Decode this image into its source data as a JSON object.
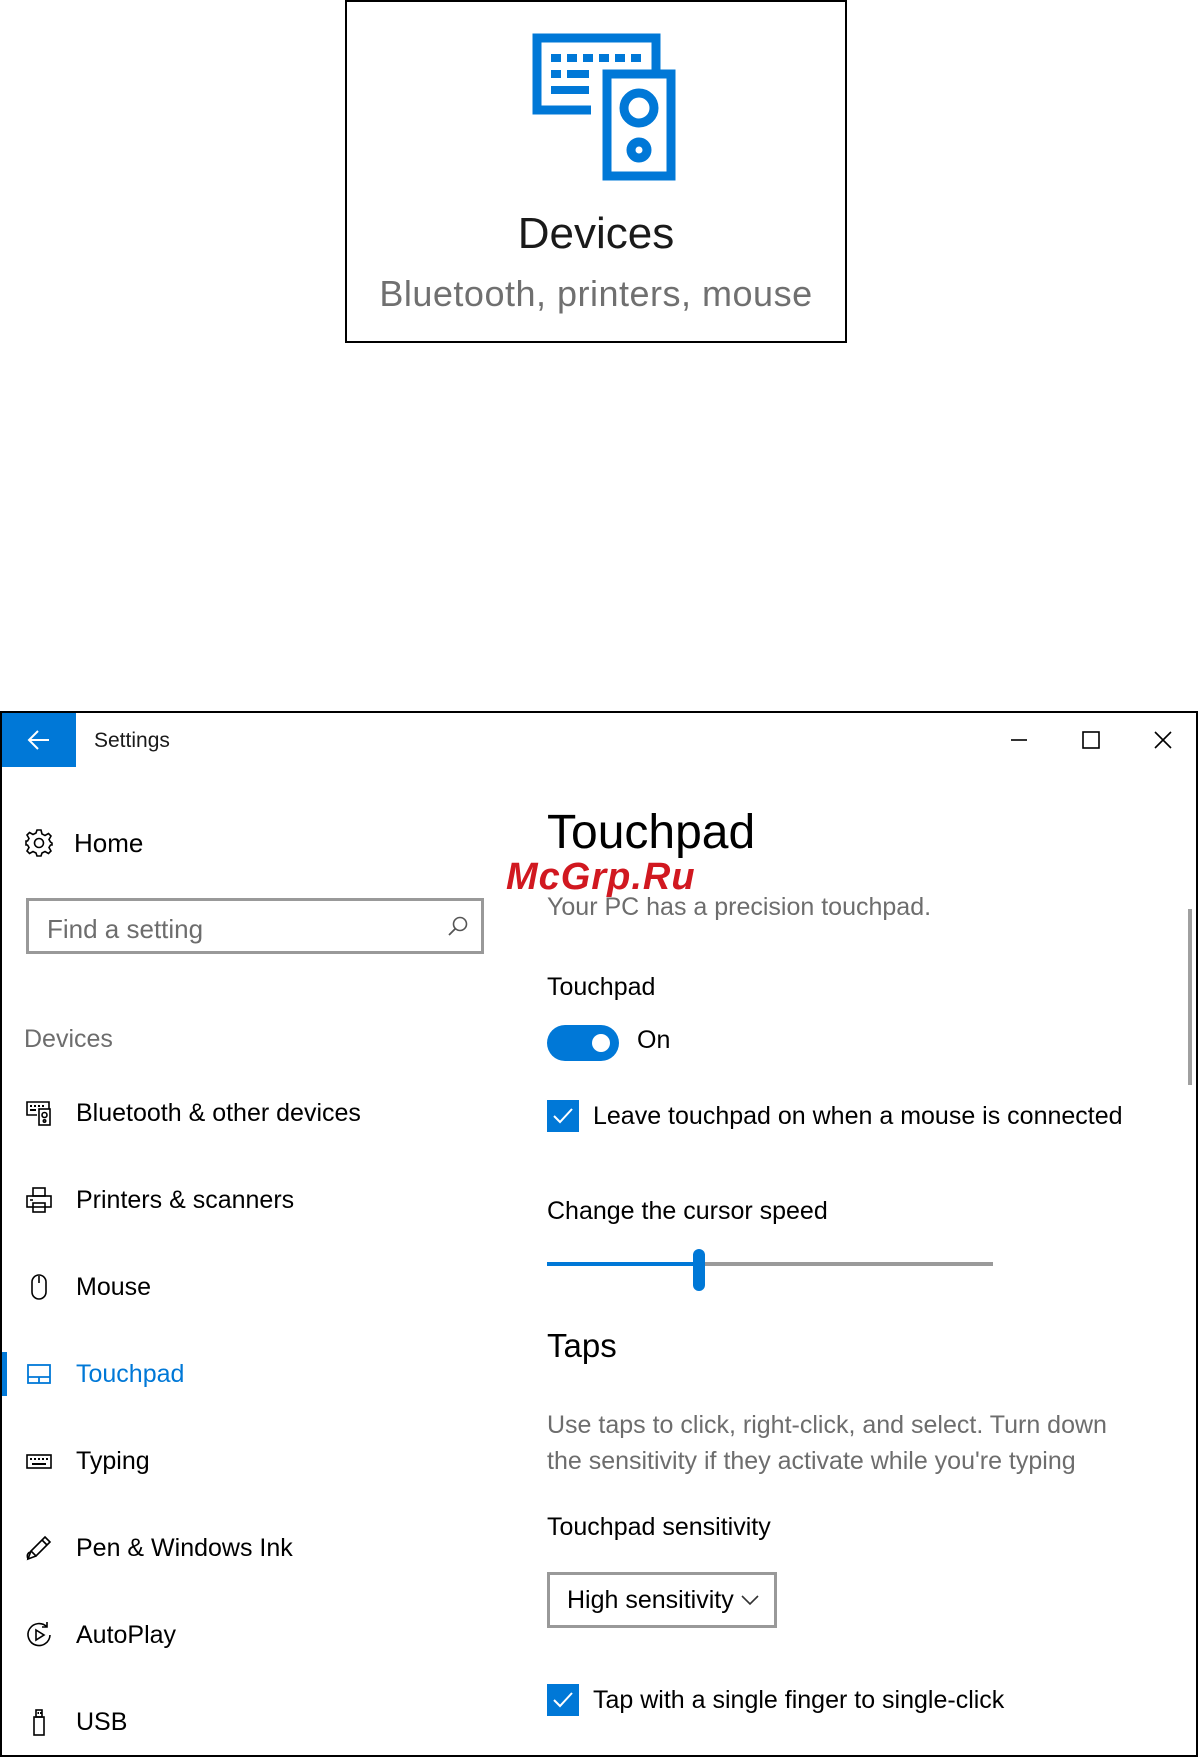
{
  "tile": {
    "title": "Devices",
    "subtitle": "Bluetooth, printers, mouse",
    "icon": "devices-icon",
    "accent": "#0078d7"
  },
  "watermark": "McGrp.Ru",
  "window": {
    "title": "Settings",
    "back_icon": "arrow-left-icon",
    "controls": [
      "minimize-icon",
      "maximize-icon",
      "close-icon"
    ]
  },
  "sidebar": {
    "home": {
      "label": "Home",
      "icon": "gear-icon"
    },
    "search": {
      "placeholder": "Find a setting",
      "icon": "search-icon"
    },
    "section": "Devices",
    "items": [
      {
        "label": "Bluetooth & other devices",
        "icon": "bluetooth-devices-icon",
        "active": false
      },
      {
        "label": "Printers & scanners",
        "icon": "printer-icon",
        "active": false
      },
      {
        "label": "Mouse",
        "icon": "mouse-icon",
        "active": false
      },
      {
        "label": "Touchpad",
        "icon": "touchpad-icon",
        "active": true
      },
      {
        "label": "Typing",
        "icon": "keyboard-icon",
        "active": false
      },
      {
        "label": "Pen & Windows Ink",
        "icon": "pen-icon",
        "active": false
      },
      {
        "label": "AutoPlay",
        "icon": "autoplay-icon",
        "active": false
      },
      {
        "label": "USB",
        "icon": "usb-icon",
        "active": false
      }
    ]
  },
  "main": {
    "title": "Touchpad",
    "subtitle": "Your PC has a precision touchpad.",
    "touchpad_label": "Touchpad",
    "toggle_state": "On",
    "toggle_on": true,
    "leave_on_label": "Leave touchpad on when a mouse is connected",
    "leave_on_checked": true,
    "cursor_speed_label": "Change the cursor speed",
    "cursor_speed_fraction": 0.34,
    "taps_heading": "Taps",
    "taps_description": "Use taps to click, right-click, and select. Turn down the sensitivity if they activate while you're typing",
    "sensitivity_label": "Touchpad sensitivity",
    "sensitivity_value": "High sensitivity",
    "single_tap_label": "Tap with a single finger to single-click",
    "single_tap_checked": true
  }
}
